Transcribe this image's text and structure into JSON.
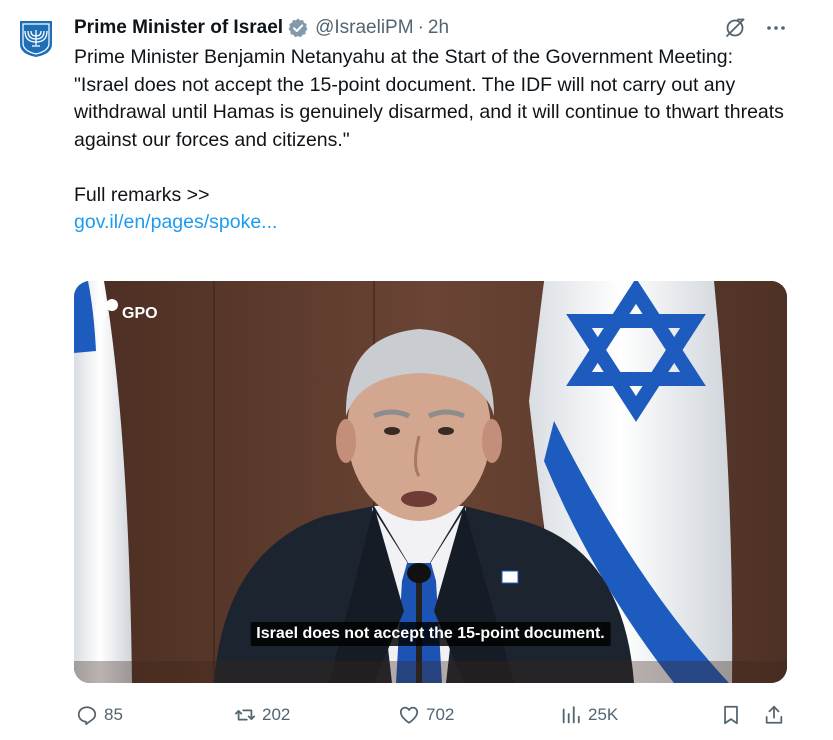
{
  "author": {
    "display_name": "Prime Minister of Israel",
    "handle": "@IsraeliPM",
    "separator": "·",
    "time": "2h"
  },
  "tweet": {
    "line1": "Prime Minister Benjamin Netanyahu at the Start of the Government Meeting:",
    "line2": "\"Israel does not accept the 15-point document. The IDF will not carry out any withdrawal until Hamas is genuinely disarmed, and it will continue to thwart threats against our forces and citizens.\"",
    "line3": "Full remarks >>",
    "link": "gov.il/en/pages/spoke..."
  },
  "media": {
    "watermark": "GPO",
    "caption": "Israel does not accept the 15-point document."
  },
  "stats": {
    "replies": "85",
    "reposts": "202",
    "likes": "702",
    "views": "25K"
  },
  "colors": {
    "accent": "#1d9bf0",
    "secondary_text": "#536471",
    "primary_text": "#0f1419",
    "verified_badge": "#829aab"
  },
  "icons": [
    "emblem-icon",
    "verified-badge-icon",
    "grok-icon",
    "more-icon",
    "gpo-logo-icon",
    "reply-icon",
    "repost-icon",
    "like-icon",
    "views-icon",
    "bookmark-icon",
    "share-icon"
  ]
}
